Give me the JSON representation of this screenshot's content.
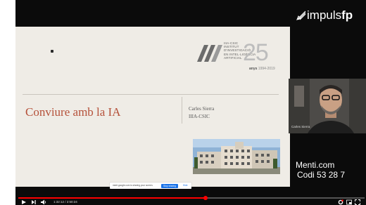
{
  "slide": {
    "logo_lines": [
      "IIIA-CSIC",
      "INSTITUT",
      "D'INVESTIGACIÓ",
      "EN INTEL·LIGÈNCIA",
      "ARTIFICIAL"
    ],
    "logo_number": "25",
    "logo_anys": "anys",
    "logo_years": "1994-2019",
    "title": "Conviure amb la IA",
    "speaker_name": "Carles Sierra",
    "speaker_org": "IIIA-CSIC"
  },
  "share_bar": {
    "message": "meet.google.com is sharing your screen.",
    "stop_label": "Stop sharing",
    "hide_label": "Hide"
  },
  "brand": {
    "prefix": "impuls",
    "suffix": "fp"
  },
  "webcam": {
    "label": "Carles Sierra"
  },
  "menti": {
    "line1": "Menti.com",
    "line2": "Codi 53 28 7"
  },
  "player": {
    "time": "1:32:12 / 2:50:24",
    "progress": 0.54,
    "accent_color": "#ff0000"
  },
  "icons": [
    "play-icon",
    "next-icon",
    "volume-icon",
    "settings-icon",
    "miniplayer-icon",
    "fullscreen-icon",
    "impuls-logo-icon"
  ]
}
